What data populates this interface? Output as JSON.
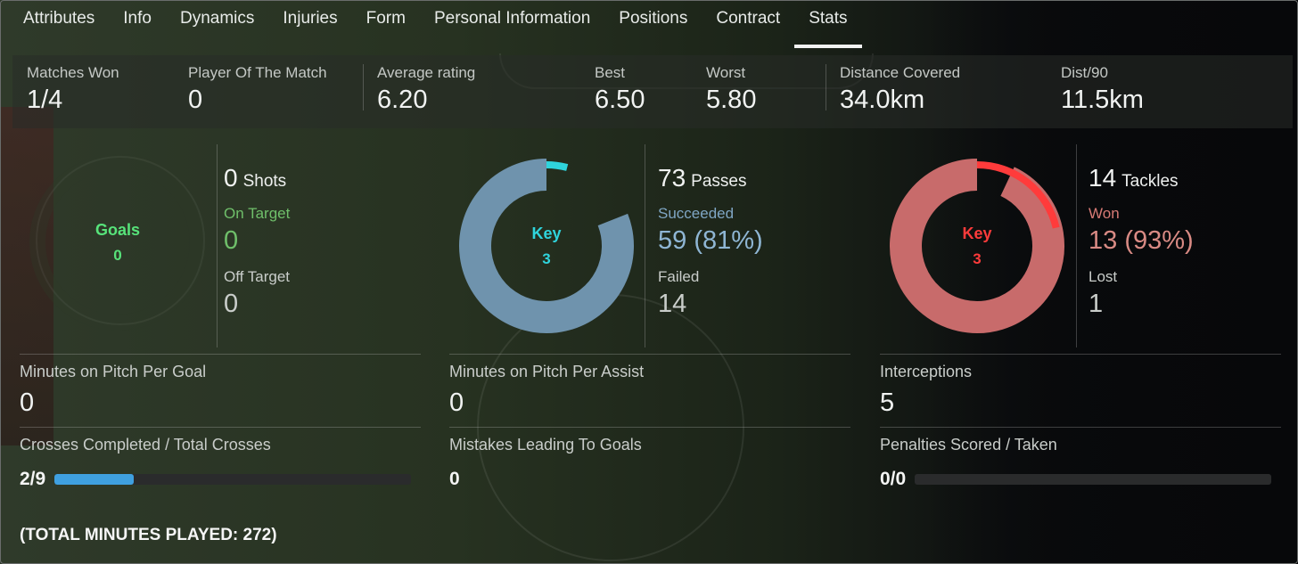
{
  "tabs": [
    {
      "label": "Attributes"
    },
    {
      "label": "Info"
    },
    {
      "label": "Dynamics"
    },
    {
      "label": "Injuries"
    },
    {
      "label": "Form"
    },
    {
      "label": "Personal Information"
    },
    {
      "label": "Positions"
    },
    {
      "label": "Contract"
    },
    {
      "label": "Stats",
      "active": true
    }
  ],
  "summary": {
    "matches_won": {
      "label": "Matches Won",
      "value": "1/4"
    },
    "potm": {
      "label": "Player Of The Match",
      "value": "0"
    },
    "avg_rating": {
      "label": "Average rating",
      "value": "6.20"
    },
    "best": {
      "label": "Best",
      "value": "6.50"
    },
    "worst": {
      "label": "Worst",
      "value": "5.80"
    },
    "distance": {
      "label": "Distance Covered",
      "value": "34.0km"
    },
    "dist90": {
      "label": "Dist/90",
      "value": "11.5km"
    }
  },
  "shots": {
    "donut_label": "Goals",
    "donut_value": "0",
    "total": "0",
    "total_word": "Shots",
    "primary_label": "On Target",
    "primary_value": "0",
    "secondary_label": "Off Target",
    "secondary_value": "0",
    "primary_fraction": 0,
    "key_fraction": 0,
    "colors": {
      "ring": "#2e3a29",
      "key": "#57e37a",
      "label": "#6fbf6a",
      "value": "#6fbf6a"
    }
  },
  "passes": {
    "donut_label": "Key",
    "donut_value": "3",
    "total": "73",
    "total_word": "Passes",
    "primary_label": "Succeeded",
    "primary_value": "59 (81%)",
    "secondary_label": "Failed",
    "secondary_value": "14",
    "primary_fraction": 0.81,
    "key_fraction": 0.041,
    "colors": {
      "ring": "#6f93ad",
      "key": "#2fd4dc",
      "label": "#7fa6c4",
      "value": "#8fb6d4"
    }
  },
  "tackles": {
    "donut_label": "Key",
    "donut_value": "3",
    "total": "14",
    "total_word": "Tackles",
    "primary_label": "Won",
    "primary_value": "13 (93%)",
    "secondary_label": "Lost",
    "secondary_value": "1",
    "primary_fraction": 0.93,
    "key_fraction": 0.214,
    "colors": {
      "ring": "#c86b6b",
      "key": "#ff3b3b",
      "label": "#d77a75",
      "value": "#d98a84"
    }
  },
  "details": {
    "min_per_goal": {
      "label": "Minutes on Pitch Per Goal",
      "value": "0"
    },
    "min_per_assist": {
      "label": "Minutes on Pitch Per Assist",
      "value": "0"
    },
    "interceptions": {
      "label": "Interceptions",
      "value": "5"
    },
    "crosses": {
      "label": "Crosses Completed / Total Crosses",
      "value": "2/9",
      "fraction": 0.222
    },
    "mistakes": {
      "label": "Mistakes Leading To Goals",
      "value": "0"
    },
    "penalties": {
      "label": "Penalties Scored / Taken",
      "value": "0/0",
      "fraction": 0
    }
  },
  "footer": "(TOTAL MINUTES PLAYED: 272)"
}
